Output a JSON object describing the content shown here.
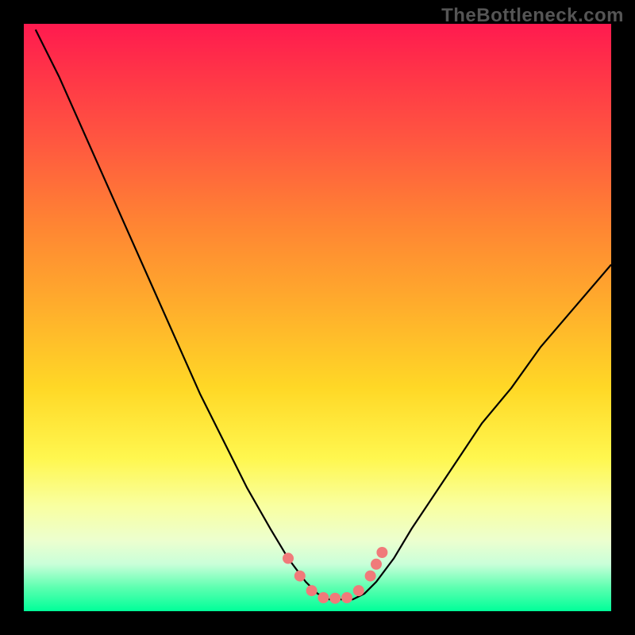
{
  "watermark": "TheBottleneck.com",
  "chart_data": {
    "type": "line",
    "title": "",
    "xlabel": "",
    "ylabel": "",
    "xlim": [
      0,
      100
    ],
    "ylim": [
      0,
      100
    ],
    "series": [
      {
        "name": "bottleneck-curve",
        "x": [
          2,
          6,
          10,
          14,
          18,
          22,
          26,
          30,
          34,
          38,
          42,
          45,
          48,
          50,
          52,
          54,
          56,
          58,
          60,
          63,
          66,
          70,
          74,
          78,
          83,
          88,
          94,
          100
        ],
        "y": [
          99,
          91,
          82,
          73,
          64,
          55,
          46,
          37,
          29,
          21,
          14,
          9,
          5,
          3,
          2,
          2,
          2,
          3,
          5,
          9,
          14,
          20,
          26,
          32,
          38,
          45,
          52,
          59
        ]
      }
    ],
    "markers": {
      "name": "trough-markers",
      "color": "#f07a7a",
      "points": [
        {
          "x": 45,
          "y": 9
        },
        {
          "x": 47,
          "y": 6
        },
        {
          "x": 49,
          "y": 3.5
        },
        {
          "x": 51,
          "y": 2.3
        },
        {
          "x": 53,
          "y": 2.2
        },
        {
          "x": 55,
          "y": 2.3
        },
        {
          "x": 57,
          "y": 3.5
        },
        {
          "x": 59,
          "y": 6
        },
        {
          "x": 60,
          "y": 8
        },
        {
          "x": 61,
          "y": 10
        }
      ],
      "radius_px": 7
    }
  }
}
